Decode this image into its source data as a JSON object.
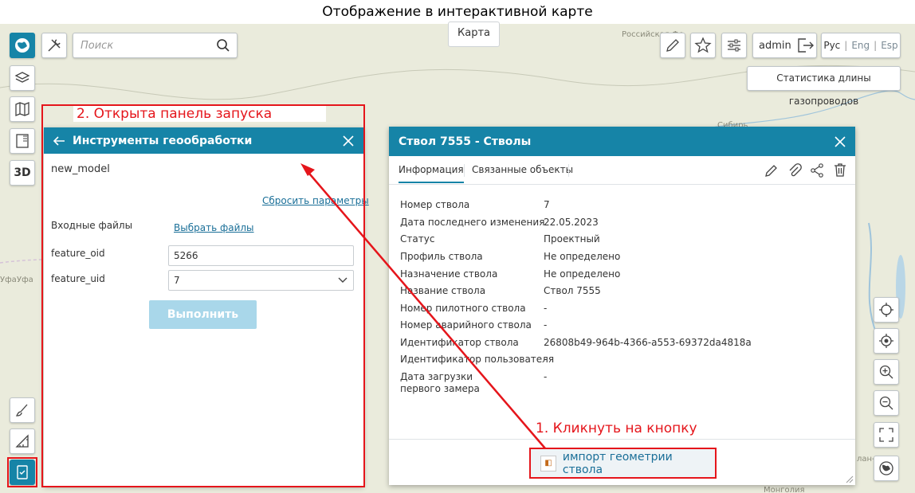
{
  "page_caption": "Отображение в интерактивной карте",
  "map": {
    "labels": [
      "Российская Фе",
      "Сибирь",
      "Уфа",
      "Уфа",
      "Монголия",
      "лан-Ба"
    ],
    "active_tab": "Карта"
  },
  "toolbar": {
    "search_placeholder": "Поиск",
    "user": "admin",
    "languages": [
      "Рус",
      "Eng",
      "Esp"
    ],
    "stats_button": "Статистика длины газопроводов",
    "btn_3d": "3D"
  },
  "annotations": {
    "panel_opened": "2. Открыта панель запуска",
    "click_button": "1. Кликнуть на кнопку"
  },
  "geo_panel": {
    "title": "Инструменты геообработки",
    "model_name": "new_model",
    "reset_link": "Сбросить параметры",
    "input_files_label": "Входные файлы",
    "choose_files_link": "Выбрать файлы",
    "feature_oid_label": "feature_oid",
    "feature_oid_value": "5266",
    "feature_uid_label": "feature_uid",
    "feature_uid_value": "7",
    "run_button": "Выполнить"
  },
  "object_card": {
    "title": "Ствол 7555 - Стволы",
    "tabs": [
      "Информация",
      "Связанные объекты"
    ],
    "properties": [
      {
        "name": "Номер ствола",
        "value": "7"
      },
      {
        "name": "Дата последнего изменения",
        "value": "22.05.2023"
      },
      {
        "name": "Статус",
        "value": "Проектный"
      },
      {
        "name": "Профиль ствола",
        "value": "Не определено"
      },
      {
        "name": "Назначение ствола",
        "value": "Не определено"
      },
      {
        "name": "Название ствола",
        "value": "Ствол 7555"
      },
      {
        "name": "Номер пилотного ствола",
        "value": "-"
      },
      {
        "name": "Номер аварийного ствола",
        "value": "-"
      },
      {
        "name": "Идентификатор ствола",
        "value": "26808b49-964b-4366-a553-69372da4818a"
      },
      {
        "name": "Идентификатор пользователя",
        "value": "-"
      },
      {
        "name": "Дата загрузки первого замера",
        "value": "-"
      }
    ],
    "import_button": "импорт геометрии ствола"
  },
  "colors": {
    "accent": "#1684a7",
    "annotation": "#e5151b"
  }
}
